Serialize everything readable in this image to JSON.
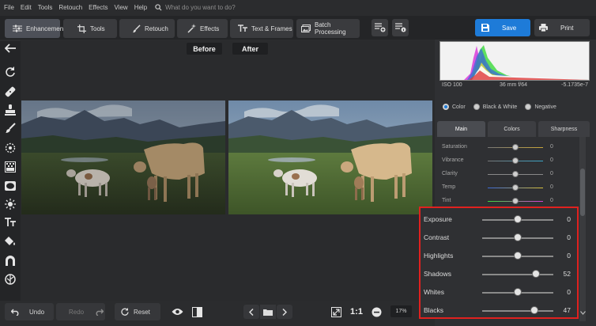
{
  "menu": {
    "items": [
      "File",
      "Edit",
      "Tools",
      "Retouch",
      "Effects",
      "View",
      "Help"
    ],
    "search_placeholder": "What do you want to do?"
  },
  "toolbar": {
    "tabs": [
      "Enhancement",
      "Tools",
      "Retouch",
      "Effects",
      "Text & Frames",
      "Batch Processing"
    ],
    "active_tab": "Enhancement",
    "save_label": "Save",
    "print_label": "Print"
  },
  "canvas": {
    "before_label": "Before",
    "after_label": "After"
  },
  "histogram": {
    "iso": "ISO 100",
    "lens": "36 mm f/64",
    "exposure": "-5.1735e-7"
  },
  "color_mode": {
    "options": [
      "Color",
      "Black & White",
      "Negative"
    ],
    "selected": "Color"
  },
  "panel_tabs": {
    "items": [
      "Main",
      "Colors",
      "Sharpness"
    ],
    "active": "Main"
  },
  "main_sliders": [
    {
      "label": "Saturation",
      "value": "0",
      "level": 0.5
    },
    {
      "label": "Vibrance",
      "value": "0",
      "level": 0.5
    },
    {
      "label": "Clarity",
      "value": "0",
      "level": 0.5
    },
    {
      "label": "Temp",
      "value": "0",
      "level": 0.5
    },
    {
      "label": "Tint",
      "value": "0",
      "level": 0.5
    }
  ],
  "tone_sliders": [
    {
      "label": "Exposure",
      "value": "0",
      "level": 0.5
    },
    {
      "label": "Contrast",
      "value": "0",
      "level": 0.5
    },
    {
      "label": "Highlights",
      "value": "0",
      "level": 0.5
    },
    {
      "label": "Shadows",
      "value": "52",
      "level": 0.76
    },
    {
      "label": "Whites",
      "value": "0",
      "level": 0.5
    },
    {
      "label": "Blacks",
      "value": "47",
      "level": 0.735
    }
  ],
  "bottom": {
    "undo_label": "Undo",
    "redo_label": "Redo",
    "reset_label": "Reset",
    "zoom_ratio": "1:1",
    "zoom_percent": "17%"
  },
  "colors": {
    "accent": "#1e7bd8",
    "highlight_border": "#e0211f"
  }
}
